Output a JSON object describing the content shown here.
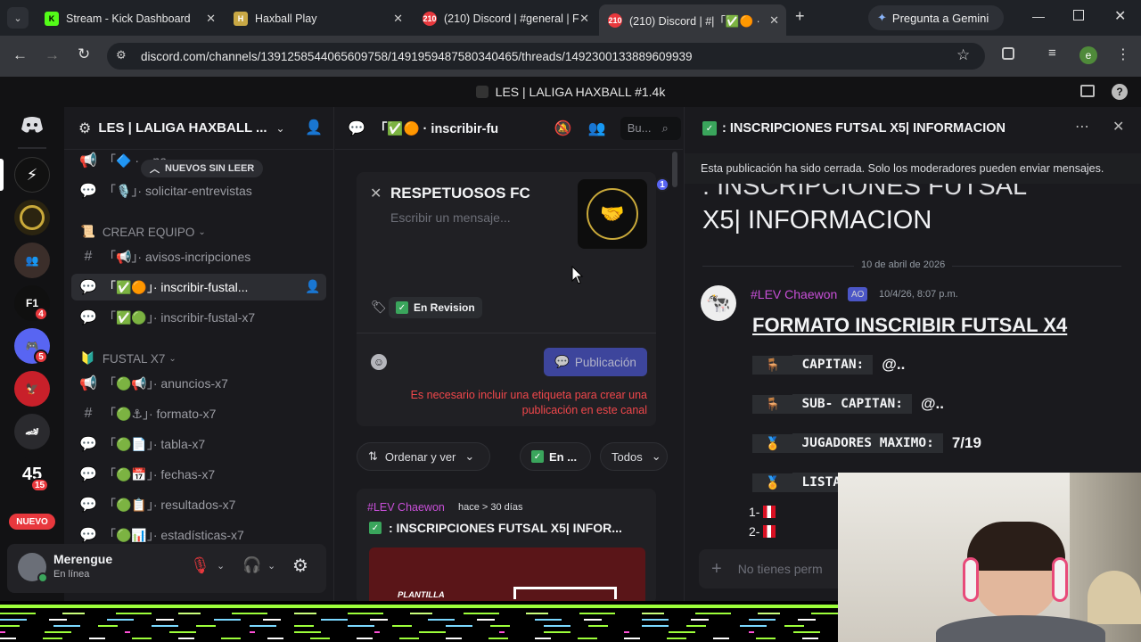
{
  "browser": {
    "tabs": [
      {
        "title": "Stream - Kick Dashboard",
        "icon": "kick-icon",
        "color": "#53fc18"
      },
      {
        "title": "Haxball Play",
        "icon": "haxball-icon",
        "color": "#c8a845"
      },
      {
        "title": "(210) Discord | #general | F",
        "icon": "discord-icon",
        "color": "#e8383d"
      },
      {
        "title": "(210) Discord | #|「✅🟠 ·",
        "icon": "discord-icon",
        "color": "#e8383d"
      }
    ],
    "gemini_label": "Pregunta a Gemini",
    "url": "discord.com/channels/1391258544065609758/1491959487580340465/threads/1492300133889609939",
    "profile_letter": "e"
  },
  "discord": {
    "window_title": "LES | LALIGA HAXBALL #1.4k",
    "guild_badges": {
      "f1": "4",
      "gamer": "5",
      "n45": "15",
      "nuevo": "NUEVO"
    },
    "server_name": "LES | LALIGA HAXBALL ...",
    "new_unread": "NUEVOS SIN LEER",
    "channels": {
      "c0": "「🔷 · ...na",
      "c1": "「🎙️」· solicitar-entrevistas",
      "cat1": "CREAR EQUIPO",
      "c2": "「📢」· avisos-incripciones",
      "c3": "「✅🟠」· inscribir-fustal...",
      "c4": "「✅🟢」· inscribir-fustal-x7",
      "cat2": "FUSTAL X7",
      "c5": "「🟢📢」· anuncios-x7",
      "c6": "「🟢⚓」· formato-x7",
      "c7": "「🟢📄」· tabla-x7",
      "c8": "「🟢📅」· fechas-x7",
      "c9": "「🟢📋」· resultados-x7",
      "c10": "「🟢📊」· estadísticas-x7"
    },
    "user": {
      "name": "Merengue",
      "status": "En línea"
    },
    "forum": {
      "header_title": "「✅🟠 · inscribir-fu",
      "search_placeholder": "Bu...",
      "composer_title": "RESPETUOSOS FC",
      "composer_placeholder": "Escribir un mensaje...",
      "composer_badge": "1",
      "tag_label": "En Revision",
      "publish_button": "Publicación",
      "error_text": "Es necesario incluir una etiqueta para crear una publicación en este canal",
      "sort_label": "Ordenar y ver",
      "filter_tag": "En ...",
      "filter_all": "Todos",
      "post_author": "#LEV Chaewon",
      "post_time": "hace > 30 días",
      "post_title": ": INSCRIPCIONES FUTSAL X5| INFOR...",
      "post_image_text": "PLANTILLA"
    },
    "thread": {
      "header_title": ": INSCRIPCIONES FUTSAL X5| INFORMACION",
      "closed_notice": "Esta publicación ha sido cerrada. Solo los moderadores pueden enviar mensajes.",
      "big_title_line1": ": INSCRIPCIONES FUTSAL",
      "big_title_line2": "X5| INFORMACION",
      "date_divider": "10 de abril de 2026",
      "msg_author": "#LEV Chaewon",
      "msg_tag": "AO",
      "msg_time": "10/4/26, 8:07 p.m.",
      "msg_heading": "FORMATO INSCRIBIR FUTSAL X4",
      "line_capitan": "CAPITAN:",
      "line_capitan_val": "@..",
      "line_sub": "SUB- CAPITAN:",
      "line_sub_val": "@..",
      "line_jug": "JUGADORES MAXIMO:",
      "line_jug_val": "7/19",
      "line_lista": "LISTA",
      "num1": "1-",
      "num2": "2-",
      "input_placeholder": "No tienes perm"
    }
  }
}
